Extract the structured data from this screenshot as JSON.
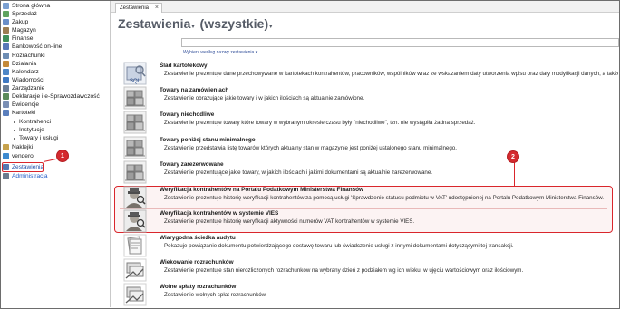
{
  "sidebar": {
    "items": [
      {
        "label": "Strona główna",
        "color": "#7a9fd1"
      },
      {
        "label": "Sprzedaż",
        "color": "#5fa35f"
      },
      {
        "label": "Zakup",
        "color": "#6a8fc9"
      },
      {
        "label": "Magazyn",
        "color": "#9b7d53"
      },
      {
        "label": "Finanse",
        "color": "#3f8f5a"
      },
      {
        "label": "Bankowość on-line",
        "color": "#5878b9"
      },
      {
        "label": "Rozrachunki",
        "color": "#6e8db3"
      },
      {
        "label": "Działania",
        "color": "#c48a3a"
      },
      {
        "label": "Kalendarz",
        "color": "#4d86c6"
      },
      {
        "label": "Wiadomości",
        "color": "#3f79c2"
      },
      {
        "label": "Zarządzanie",
        "color": "#6b7e96"
      },
      {
        "label": "Deklaracje i e-Sprawozdawczość",
        "color": "#5b8b5b"
      },
      {
        "label": "Ewidencje",
        "color": "#7b8fb4"
      },
      {
        "label": "Kartoteki",
        "color": "#5b7fbd"
      }
    ],
    "subitems": [
      "Kontrahenci",
      "Instytucje",
      "Towary i usługi"
    ],
    "bottom_items": [
      {
        "label": "Naklejki",
        "color": "#c7a24c"
      },
      {
        "label": "vendero",
        "color": "#3d8ad0"
      },
      {
        "label": "Zestawienia",
        "color": "#5578b3"
      },
      {
        "label": "Administracja",
        "color": "#6b7c90"
      }
    ]
  },
  "tab": {
    "label": "Zestawienia",
    "close": "×"
  },
  "header": {
    "title": "Zestawienia",
    "filter": "(wszystkie)",
    "caret": "▾"
  },
  "search": {
    "placeholder": "",
    "hint": "Wybierz według nazwy zestawienia ▾"
  },
  "callouts": {
    "one": "1",
    "two": "2"
  },
  "reports": [
    {
      "title": "Ślad kartotekowy",
      "desc": "Zestawienie prezentuje dane przechowywane w kartotekach kontrahentów, pracowników, wspólników wraz ze wskazaniem daty utworzenia wpisu oraz daty modyfikacji danych, a także",
      "icon": "sql-report-icon"
    },
    {
      "title": "Towary na zamówieniach",
      "desc": "Zestawienie obrazujące jakie towary i w jakich ilościach są aktualnie zamówione.",
      "icon": "stock-report-icon"
    },
    {
      "title": "Towary niechodliwe",
      "desc": "Zestawienie prezentuje towary które towary w wybranym okresie czasu były \"niechodliwe\", tzn. nie wystąpiła żadna sprzedaż.",
      "icon": "stock-report-icon"
    },
    {
      "title": "Towary poniżej stanu minimalnego",
      "desc": "Zestawienie przedstawia listę towarów których aktualny stan w magazynie jest poniżej ustalonego stanu minimalnego.",
      "icon": "stock-report-icon"
    },
    {
      "title": "Towary zarezerwowane",
      "desc": "Zestawienie prezentujące jakie towary, w jakich ilościach i jakimi dokumentami są aktualnie zarezerwowane.",
      "icon": "stock-report-icon"
    },
    {
      "title": "Weryfikacja kontrahentów na Portalu Podatkowym Ministerstwa Finansów",
      "desc": "Zestawienie prezentuje historię weryfikacji kontrahentów za pomocą usługi 'Sprawdzenie statusu podmiotu w VAT' udostępnionej na Portalu Podatkowym Ministerstwa Finansów.",
      "icon": "inspector-report-icon"
    },
    {
      "title": "Weryfikacja kontrahentów w systemie VIES",
      "desc": "Zestawienie prezentuje historię weryfikacji aktywności numerów VAT kontrahentów w systemie VIES.",
      "icon": "inspector-report-icon"
    },
    {
      "title": "Wiarygodna ścieżka audytu",
      "desc": "Pokazuje powiązanie dokumentu potwierdzającego dostawę towaru lub świadczenie usługi z innymi dokumentami dotyczącymi tej transakcji.",
      "icon": "documents-report-icon"
    },
    {
      "title": "Wiekowanie rozrachunków",
      "desc": "Zestawienie prezentuje stan nierozliczonych rozrachunków na wybrany dzień z podziałem wg ich wieku, w ujęciu wartościowym oraz ilościowym.",
      "icon": "payments-report-icon"
    },
    {
      "title": "Wolne spłaty rozrachunków",
      "desc": "Zestawienie wolnych spłat rozrachunków",
      "icon": "payments-report-icon"
    }
  ]
}
